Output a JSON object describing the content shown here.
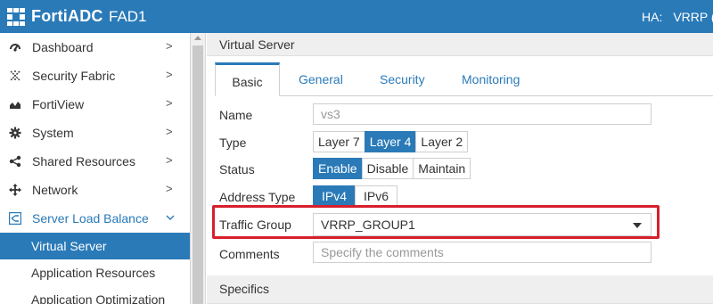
{
  "header": {
    "brand": "FortiADC",
    "device": "FAD1",
    "ha_label": "HA:",
    "ha_value": "VRRP (",
    "accent_color": "#2a7ab8"
  },
  "sidebar": {
    "items": [
      {
        "label": "Dashboard",
        "icon": "dashboard-icon"
      },
      {
        "label": "Security Fabric",
        "icon": "security-fabric-icon"
      },
      {
        "label": "FortiView",
        "icon": "fortiview-chart-icon"
      },
      {
        "label": "System",
        "icon": "gear-icon"
      },
      {
        "label": "Shared Resources",
        "icon": "share-icon"
      },
      {
        "label": "Network",
        "icon": "network-arrows-icon"
      },
      {
        "label": "Server Load Balance",
        "icon": "load-balance-icon"
      }
    ],
    "subitems": [
      {
        "label": "Virtual Server",
        "active": true
      },
      {
        "label": "Application Resources"
      },
      {
        "label": "Application Optimization"
      }
    ]
  },
  "content": {
    "section_title": "Virtual Server",
    "tabs": [
      "Basic",
      "General",
      "Security",
      "Monitoring"
    ],
    "active_tab": "Basic",
    "form": {
      "name_label": "Name",
      "name_value": "vs3",
      "type_label": "Type",
      "type_options": [
        "Layer 7",
        "Layer 4",
        "Layer 2"
      ],
      "type_selected": "Layer 4",
      "status_label": "Status",
      "status_options": [
        "Enable",
        "Disable",
        "Maintain"
      ],
      "status_selected": "Enable",
      "address_type_label": "Address Type",
      "address_type_options": [
        "IPv4",
        "IPv6"
      ],
      "address_type_selected": "IPv4",
      "traffic_group_label": "Traffic Group",
      "traffic_group_value": "VRRP_GROUP1",
      "comments_label": "Comments",
      "comments_placeholder": "Specify the comments"
    },
    "specifics_title": "Specifics",
    "highlight_color": "#d7202c"
  }
}
